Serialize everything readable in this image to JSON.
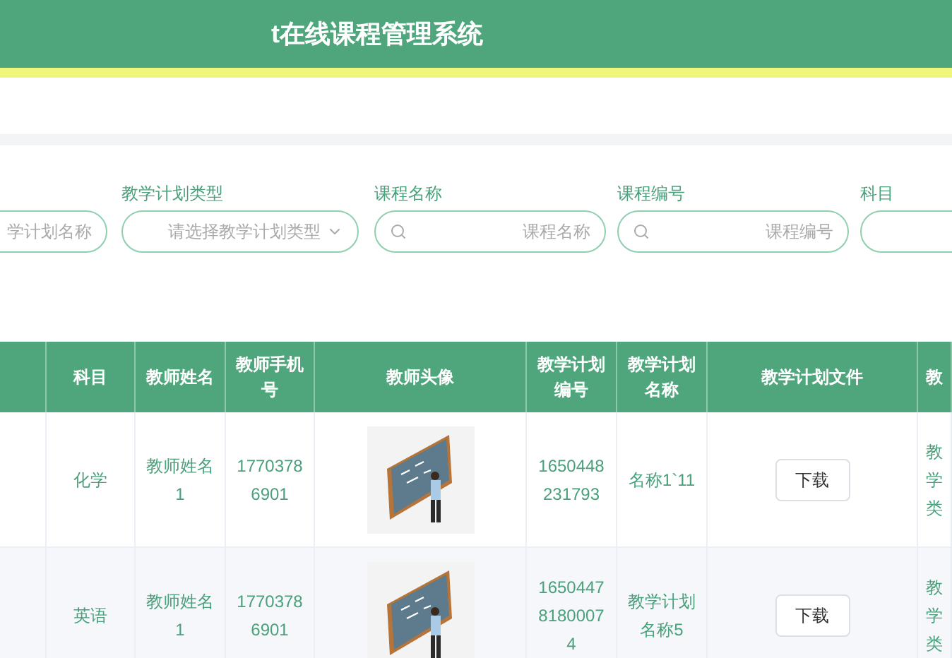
{
  "header": {
    "title": "t在线课程管理系统"
  },
  "filters": [
    {
      "kind": "input",
      "placeholder": "学计划名称"
    },
    {
      "kind": "select",
      "label": "教学计划类型",
      "placeholder": "请选择教学计划类型"
    },
    {
      "kind": "search",
      "label": "课程名称",
      "placeholder": "课程名称"
    },
    {
      "kind": "search",
      "label": "课程编号",
      "placeholder": "课程编号"
    },
    {
      "kind": "input",
      "label": "科目"
    }
  ],
  "table": {
    "columns": [
      "",
      "科目",
      "教师姓名",
      "教师手机号",
      "教师头像",
      "教学计划编号",
      "教学计划名称",
      "教学计划文件",
      "教"
    ],
    "rows": [
      {
        "subject": "化学",
        "teacher": "教师姓名1",
        "phone": "17703786901",
        "plan_no": "1650448231793",
        "plan_name": "名称1`11",
        "file_button": "下载",
        "column_9": "教学类"
      },
      {
        "subject": "英语",
        "teacher": "教师姓名1",
        "phone": "17703786901",
        "plan_no": "165044781800074",
        "plan_name": "教学计划名称5",
        "file_button": "下载",
        "column_9": "教学类"
      }
    ]
  }
}
